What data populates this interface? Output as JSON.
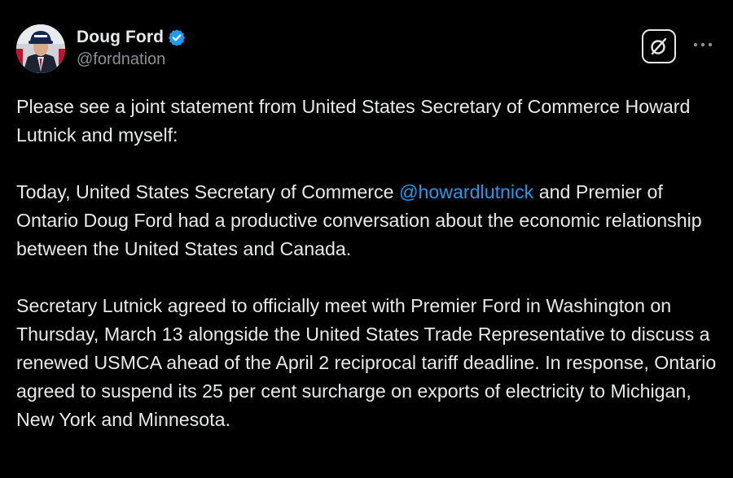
{
  "author": {
    "display_name": "Doug Ford",
    "handle": "@fordnation",
    "verified": true,
    "avatar_icon": "profile-photo"
  },
  "actions": {
    "grok_icon": "grok-icon",
    "more_icon": "more-icon"
  },
  "colors": {
    "background": "#000000",
    "text": "#e7e9ea",
    "secondary_text": "#8b9096",
    "link": "#1d9bf0",
    "verified_badge": "#1d9bf0"
  },
  "tweet": {
    "paragraph_1": "Please see a joint statement from United States Secretary of Commerce Howard Lutnick and myself:",
    "paragraph_2_before": "Today, United States Secretary of Commerce ",
    "paragraph_2_mention": "@howardlutnick",
    "paragraph_2_after": " and Premier of Ontario Doug Ford had a productive conversation about the economic relationship between the United States and Canada.",
    "paragraph_3": "Secretary Lutnick agreed to officially meet with Premier Ford in Washington on Thursday, March 13 alongside the United States Trade Representative to discuss a renewed USMCA ahead of the April 2 reciprocal tariff deadline. In response, Ontario agreed to suspend its 25 per cent surcharge on exports of electricity to Michigan, New York and Minnesota."
  }
}
